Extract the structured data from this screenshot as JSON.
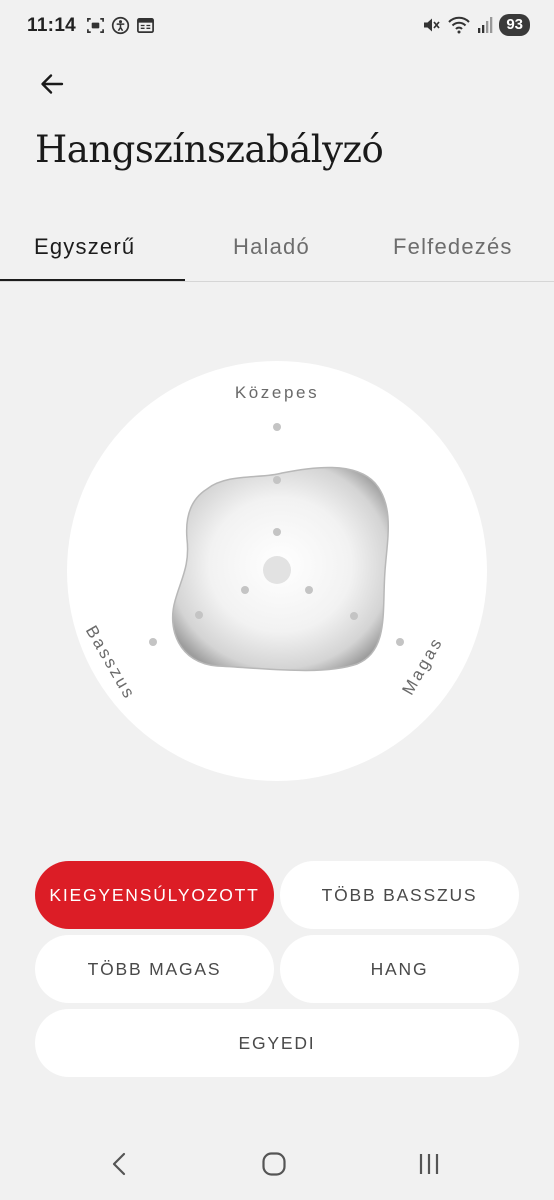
{
  "status_bar": {
    "time": "11:14",
    "battery": "93",
    "icons": [
      "screenshot-icon",
      "accessibility-icon",
      "notification-card-icon",
      "mute-icon",
      "wifi-icon",
      "signal-icon"
    ]
  },
  "header": {
    "back_icon": "arrow-left-icon",
    "title": "Hangszínszabályzó"
  },
  "tabs": [
    {
      "label": "Egyszerű",
      "active": true
    },
    {
      "label": "Haladó",
      "active": false
    },
    {
      "label": "Felfedezés",
      "active": false
    }
  ],
  "equalizer": {
    "labels": {
      "mid": "Közepes",
      "bass": "Basszus",
      "treble": "Magas"
    }
  },
  "presets": [
    {
      "label": "KIEGYENSÚLYOZOTT",
      "active": true
    },
    {
      "label": "TÖBB BASSZUS",
      "active": false
    },
    {
      "label": "TÖBB MAGAS",
      "active": false
    },
    {
      "label": "HANG",
      "active": false
    },
    {
      "label": "EGYEDI",
      "active": false
    }
  ],
  "colors": {
    "accent": "#dc1d26",
    "background": "#f1f1f1",
    "card": "#ffffff"
  },
  "nav_bar": {
    "icons": [
      "nav-back-icon",
      "nav-home-icon",
      "nav-recents-icon"
    ]
  }
}
